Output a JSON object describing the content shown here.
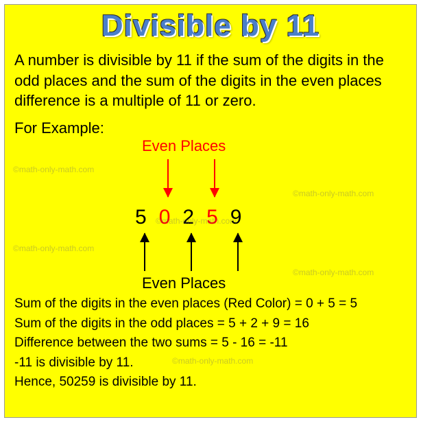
{
  "title": "Divisible by 11",
  "intro": "A number is divisible by 11 if the sum of the digits in the odd places and the sum of the digits in the even places difference is a multiple of 11 or zero.",
  "example_label": "For Example:",
  "top_arrow_label": "Even Places",
  "bottom_arrow_label": "Even Places",
  "digits": {
    "d1": "5",
    "d2": "0",
    "d3": "2",
    "d4": "5",
    "d5": "9"
  },
  "lines": {
    "l1": "Sum of the digits in the even places (Red Color)  = 0 + 5 = 5",
    "l2": "Sum of the digits in the odd places = 5 + 2 + 9 = 16",
    "l3": "Difference between the two sums = 5 - 16 = -11",
    "l4": "-11 is divisible by 11.",
    "l5": "Hence, 50259  is divisible by 11."
  },
  "watermark": "©math-only-math.com"
}
